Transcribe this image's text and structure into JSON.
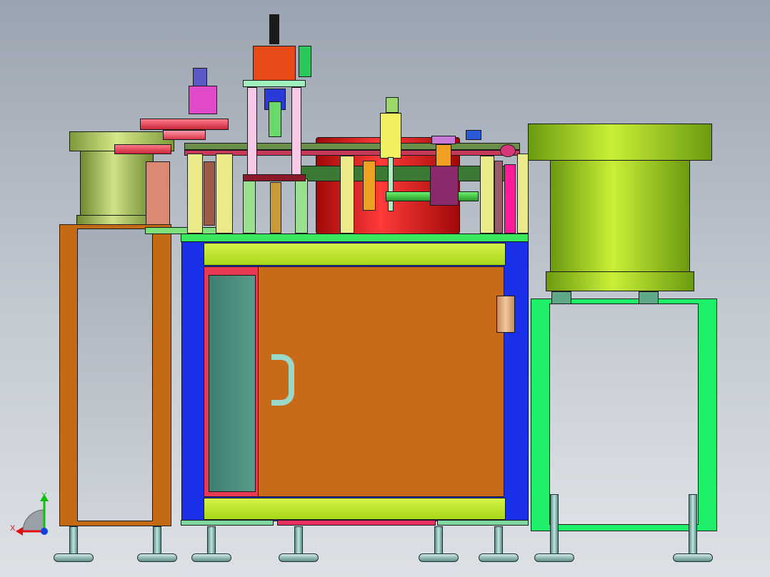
{
  "viewport": {
    "title": "",
    "background": "#b8bfc8"
  },
  "triad": {
    "x_label": "X",
    "y_label": "Y",
    "x_color": "#e01010",
    "y_color": "#10c010",
    "z_color": "#1040e0"
  },
  "colors": {
    "cabinet_frame": "#1a2fe8",
    "door": "#c96a18",
    "top_rail": "#b6ea1a",
    "left_stand": "#c46a14",
    "right_stand": "#1ef06a",
    "feeder_bowl": "#9ad82a",
    "turntable": "#e21a1a",
    "cylinder": "#e8384a",
    "vertical_column": "#e8ea8a"
  }
}
